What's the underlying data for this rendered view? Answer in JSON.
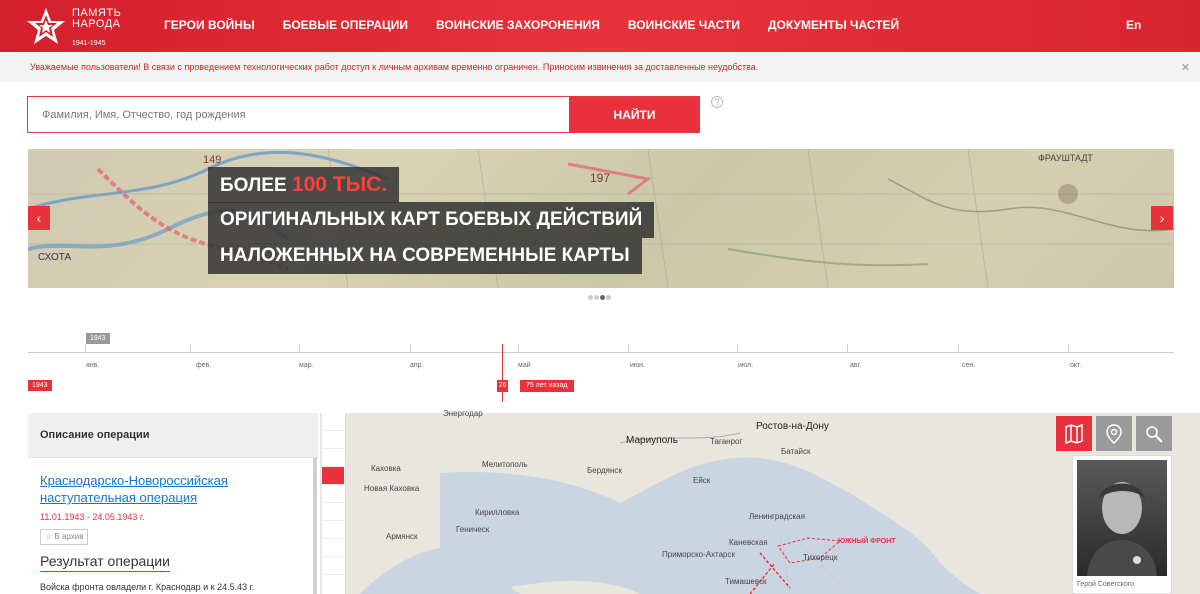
{
  "header": {
    "logo_line1": "ПАМЯТЬ",
    "logo_line2": "НАРОДА",
    "logo_years": "1941-1945",
    "nav": [
      "ГЕРОИ ВОЙНЫ",
      "БОЕВЫЕ ОПЕРАЦИИ",
      "ВОИНСКИЕ ЗАХОРОНЕНИЯ",
      "ВОИНСКИЕ ЧАСТИ",
      "ДОКУМЕНТЫ ЧАСТЕЙ"
    ],
    "lang": "En",
    "accent": "#e8313b"
  },
  "notice": {
    "text": "Уважаемые пользователи! В связи с проведением технологических работ доступ к личным архивам временно ограничен. Приносим извинения за доставленные неудобства.",
    "close": "×"
  },
  "search": {
    "placeholder": "Фамилия, Имя, Отчество, год рождения",
    "button": "НАЙТИ",
    "help": "?"
  },
  "banner": {
    "line1_prefix": "БОЛЕЕ ",
    "line1_highlight": "100 ТЫС.",
    "line2": "ОРИГИНАЛЬНЫХ КАРТ БОЕВЫХ ДЕЙСТВИЙ",
    "line3": "НАЛОЖЕННЫХ НА СОВРЕМЕННЫЕ КАРТЫ",
    "prev": "‹",
    "next": "›",
    "map_labels": [
      "149",
      "197",
      "ФРАУШТАДТ",
      "СХОТА"
    ],
    "slides": 4,
    "active_slide": 3
  },
  "timeline": {
    "year_top": "1943",
    "year_bottom": "1943",
    "months": [
      "янв.",
      "фев.",
      "мар.",
      "апр.",
      "май",
      "июн.",
      "июл.",
      "авг.",
      "сен.",
      "окт."
    ],
    "marker_day": "26",
    "marker_label": "75 лет назад"
  },
  "operation": {
    "panel_title": "Описание операции",
    "name": "Краснодарско-Новороссийская наступательная операция",
    "dates": "11.01.1943 - 24.05.1943 г.",
    "archive": "☆ В архив",
    "result_title": "Результат операции",
    "result_text": "Войска фронта овладели г. Краснодар и к 24.5.43 г."
  },
  "map": {
    "cities": [
      "Энергодар",
      "Мариуполь",
      "Таганрог",
      "Ростов-на-Дону",
      "Батайск",
      "Каховка",
      "Мелитополь",
      "Бердянск",
      "Новая Каховка",
      "Ейск",
      "Кирилловка",
      "Ленинградская",
      "Геническ",
      "Армянск",
      "Каневская",
      "Приморско-Ахтарск",
      "Тихорецк",
      "Тимашевск"
    ],
    "front_label": "ЮЖНЫЙ ФРОНТ",
    "photo_caption": "Герой Советского"
  }
}
